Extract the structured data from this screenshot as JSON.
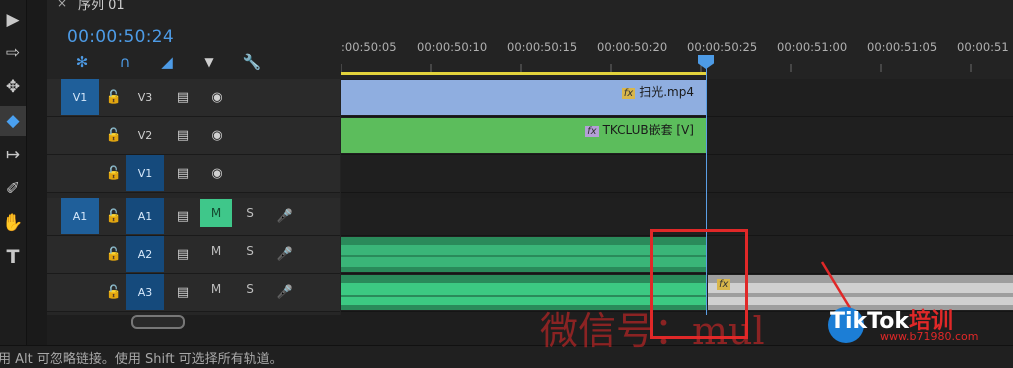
{
  "tab": {
    "close": "×",
    "title": "序列 01"
  },
  "timecode": "00:00:50:24",
  "header_icons": [
    "snap-icon",
    "magnet-icon",
    "link-icon",
    "marker-icon",
    "wrench-icon"
  ],
  "ruler": {
    "ticks": [
      ":00:50:05",
      "00:00:50:10",
      "00:00:50:15",
      "00:00:50:20",
      "00:00:50:25",
      "00:00:51:00",
      "00:00:51:05",
      "00:00:51"
    ]
  },
  "tracks": {
    "video": [
      {
        "source": "V1",
        "label": "V3",
        "clip": "扫光.mp4",
        "fx": "fx"
      },
      {
        "source": "",
        "label": "V2",
        "clip": "TKCLUB嵌套 [V]",
        "fx": "fx"
      },
      {
        "source": "",
        "label": "V1",
        "clip": "",
        "fx": ""
      }
    ],
    "audio": [
      {
        "source": "A1",
        "label": "A1",
        "m": "M",
        "s": "S"
      },
      {
        "source": "",
        "label": "A2",
        "m": "M",
        "s": "S"
      },
      {
        "source": "",
        "label": "A3",
        "m": "M",
        "s": "S",
        "fx": "fx"
      }
    ]
  },
  "status": "用 Alt 可忽略链接。使用 Shift 可选择所有轨道。",
  "watermark": "微信号：mul",
  "tiktok": {
    "brand": "TikTok",
    "cn": "培训",
    "url": "www.b71980.com"
  },
  "colors": {
    "accent": "#4d9be6",
    "video_clip_v3": "#8faee0",
    "video_clip_v2": "#5cbd5c",
    "audio_clip": "#2fae6e",
    "mute_on": "#3fc78a",
    "annotation": "#e02828"
  }
}
